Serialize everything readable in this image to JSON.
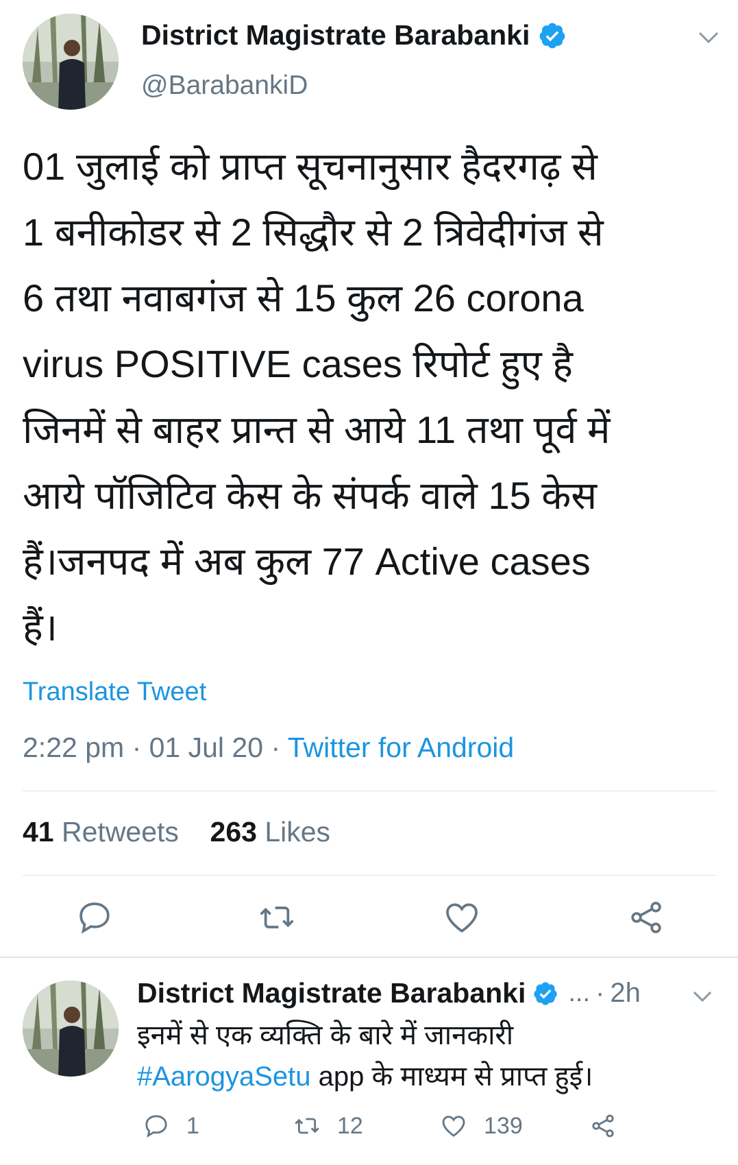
{
  "tweet": {
    "author_name": "District Magistrate Barabanki",
    "handle": "@BarabankiD",
    "body_lines": [
      "01 जुलाई को प्राप्त सूचनानुसार हैदरगढ़ से",
      "1 बनीकोडर से 2 सिद्धौर से 2 त्रिवेदीगंज से",
      "6 तथा नवाबगंज से 15 कुल 26 corona",
      "virus POSITIVE cases रिपोर्ट हुए है",
      "जिनमें से बाहर प्रान्त से आये 11 तथा पूर्व में",
      "आये पॉजिटिव केस के संपर्क वाले 15 केस",
      "हैं।जनपद में अब कुल 77 Active cases",
      "हैं।"
    ],
    "translate_label": "Translate Tweet",
    "time": "2:22 pm",
    "date": "01 Jul 20",
    "meta_sep": "·",
    "source": "Twitter for Android",
    "retweets_count": "41",
    "retweets_label": "Retweets",
    "likes_count": "263",
    "likes_label": "Likes",
    "actions": [
      "reply-icon",
      "retweet-icon",
      "like-icon",
      "share-icon"
    ]
  },
  "reply": {
    "author_name": "District Magistrate Barabanki",
    "dots": "...",
    "time_sep": "·",
    "time": "2h",
    "body_line1": "इनमें से एक व्यक्ति के बारे में जानकारी",
    "hashtag": "#AarogyaSetu",
    "body_line2_rest": " app के माध्यम से प्राप्त हुई।",
    "reply_count": "1",
    "retweet_count": "12",
    "like_count": "139"
  },
  "colors": {
    "accent": "#1b95e0",
    "secondary_text": "#657786",
    "divider": "#dfe5ea"
  }
}
